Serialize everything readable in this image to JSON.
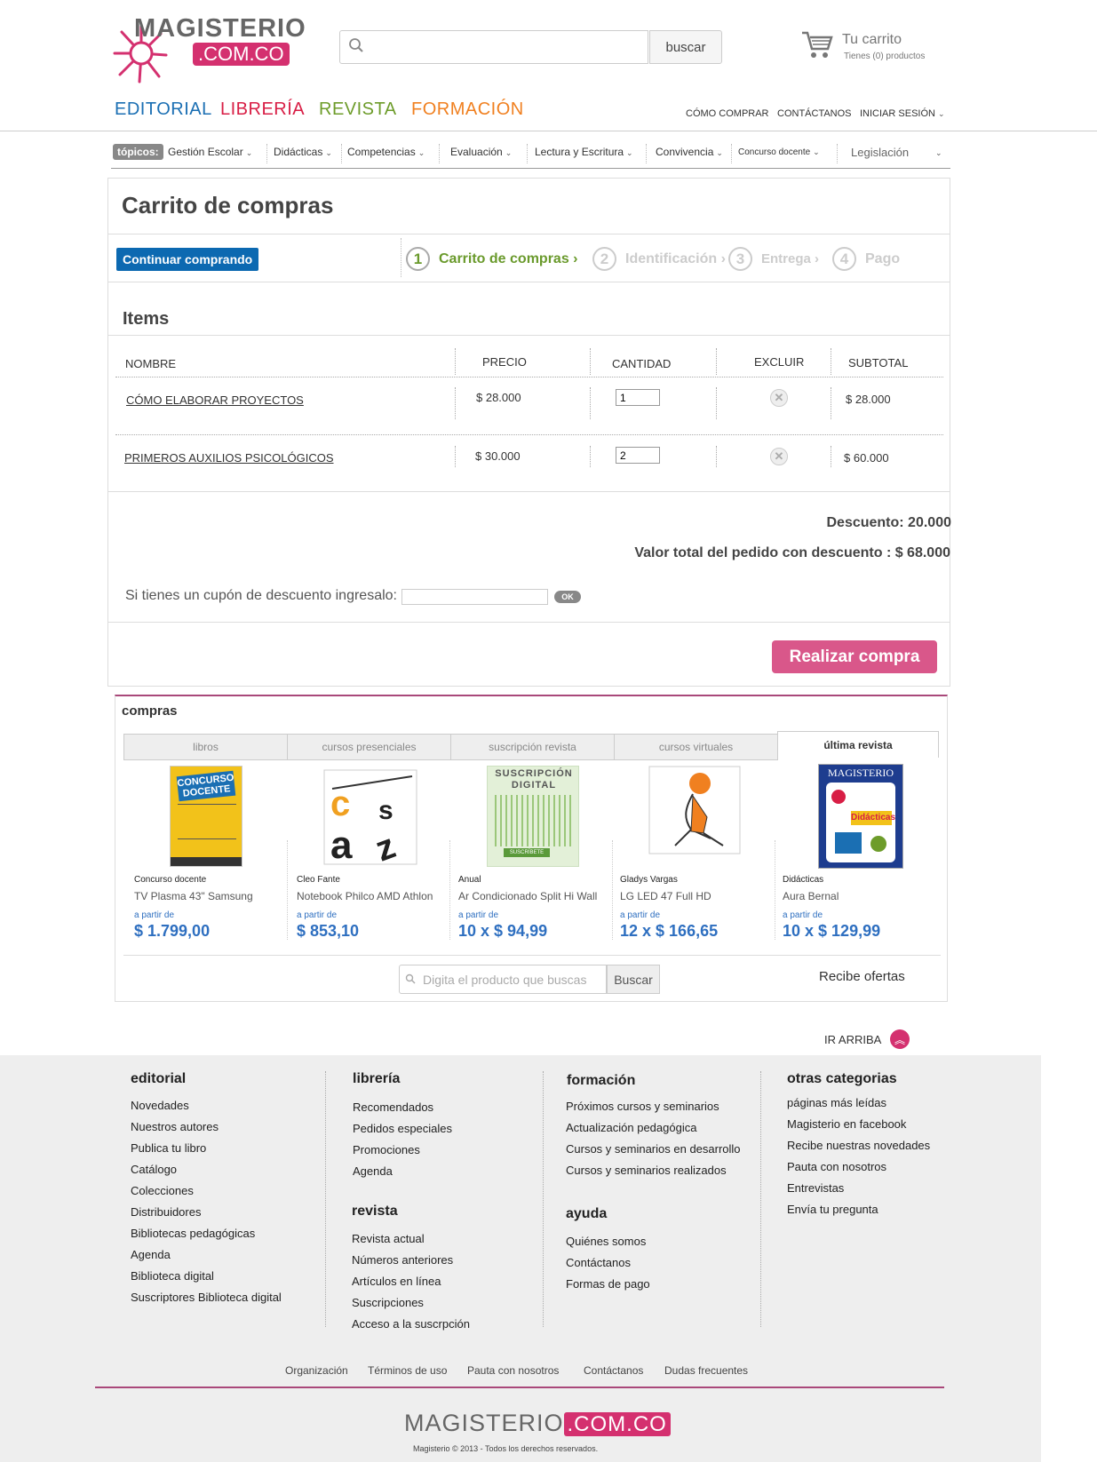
{
  "header": {
    "logo_top": "MAGISTERIO",
    "logo_bottom": ".COM.CO",
    "search_placeholder": "",
    "search_button": "buscar",
    "cart_title": "Tu carrito",
    "cart_subtitle": "Tienes (0) productos",
    "main_nav": [
      "EDITORIAL",
      "LIBRERÍA",
      "REVISTA",
      "FORMACIÓN"
    ],
    "main_nav_colors": [
      "#1b6fb3",
      "#d81e45",
      "#6d9c2a",
      "#f08020"
    ],
    "top_nav": [
      "CÓMO COMPRAR",
      "CONTÁCTANOS",
      "INICIAR SESIÓN"
    ]
  },
  "topics": {
    "label": "tópicos:",
    "items": [
      "Gestión Escolar",
      "Didácticas",
      "Competencias",
      "Evaluación",
      "Lectura y Escritura",
      "Convivencia",
      "Concurso docente",
      "Legislación"
    ]
  },
  "cart": {
    "title": "Carrito de compras",
    "continue_button": "Continuar comprando",
    "steps": [
      {
        "num": "1",
        "label": "Carrito de compras ›"
      },
      {
        "num": "2",
        "label": "Identificación ›"
      },
      {
        "num": "3",
        "label": "Entrega ›"
      },
      {
        "num": "4",
        "label": "Pago"
      }
    ],
    "items_heading": "Items",
    "columns": [
      "NOMBRE",
      "PRECIO",
      "CANTIDAD",
      "EXCLUIR",
      "SUBTOTAL"
    ],
    "rows": [
      {
        "name": "CÓMO ELABORAR PROYECTOS",
        "price": "$  28.000",
        "qty": "1",
        "subtotal": "$  28.000"
      },
      {
        "name": "PRIMEROS AUXILIOS PSICOLÓGICOS",
        "price": "$ 30.000",
        "qty": "2",
        "subtotal": "$ 60.000"
      }
    ],
    "discount": "Descuento: 20.000",
    "total": "Valor total del pedido con descuento :  $  68.000",
    "coupon_label": "Si tienes un cupón de descuento ingresalo:",
    "coupon_ok": "OK",
    "buy_button": "Realizar compra"
  },
  "compras": {
    "heading": "compras",
    "tabs": [
      "libros",
      "cursos presenciales",
      "suscripción revista",
      "cursos virtuales",
      "última revista"
    ],
    "products": [
      {
        "category": "Concurso docente",
        "name": "TV Plasma 43\" Samsung",
        "from": "a partir de",
        "price": "$ 1.799,00"
      },
      {
        "category": "Cleo Fante",
        "name": "Notebook Philco AMD Athlon",
        "from": "a partir de",
        "price": "$ 853,10"
      },
      {
        "category": "Anual",
        "name": "Ar Condicionado Split Hi Wall",
        "from": "a partir de",
        "price": "10 x $ 94,99"
      },
      {
        "category": "Gladys Vargas",
        "name": "LG LED 47 Full HD",
        "from": "a partir de",
        "price": "12 x $ 166,65"
      },
      {
        "category": "Didácticas",
        "name": "Aura Bernal",
        "from": "a partir de",
        "price": "10 x $ 129,99"
      }
    ],
    "image_texts": [
      "CONCURSO DOCENTE",
      "SUSCRIPCIÓN DIGITAL",
      "SUSCRÍBETE",
      "MAGISTERIO",
      "Didácticas"
    ],
    "search_placeholder": "Digita el producto que buscas",
    "search_button": "Buscar",
    "offers": "Recibe ofertas"
  },
  "ir_arriba": "IR ARRIBA",
  "footer": {
    "cols": [
      {
        "heading": "editorial",
        "links": [
          "Novedades",
          "Nuestros autores",
          "Publica tu libro",
          "Catálogo",
          "Colecciones",
          "Distribuidores",
          "Bibliotecas pedagógicas",
          "Agenda",
          "Biblioteca digital",
          "Suscriptores Biblioteca digital"
        ]
      },
      {
        "heading": "librería",
        "links": [
          "Recomendados",
          "Pedidos especiales",
          "Promociones",
          "Agenda"
        ]
      },
      {
        "heading": "revista",
        "links": [
          "Revista actual",
          "Números anteriores",
          "Artículos en línea",
          "Suscripciones",
          "Acceso a la suscrpción"
        ]
      },
      {
        "heading": "formación",
        "links": [
          "Próximos cursos y seminarios",
          "Actualización pedagógica",
          "Cursos y seminarios en desarrollo",
          "Cursos y seminarios realizados"
        ]
      },
      {
        "heading": "ayuda",
        "links": [
          "Quiénes somos",
          "Contáctanos",
          "Formas de pago"
        ]
      },
      {
        "heading": "otras categorias",
        "links": [
          "páginas más leídas",
          "Magisterio en facebook",
          "Recibe nuestras novedades",
          "Pauta con nosotros",
          "Entrevistas",
          "Envía tu pregunta"
        ]
      }
    ],
    "bottom_links": [
      "Organización",
      "Términos de uso",
      "Pauta con nosotros",
      "Contáctanos",
      "Dudas frecuentes"
    ],
    "logo_text": "MAGISTERIO",
    "logo_dom": ".COM.CO",
    "copyright": "Magisterio © 2013 - Todos los derechos reservados."
  },
  "colors": {
    "brand": "#d4306f",
    "accent_blue": "#0c69b1",
    "step_active": "#6a9a2c"
  }
}
